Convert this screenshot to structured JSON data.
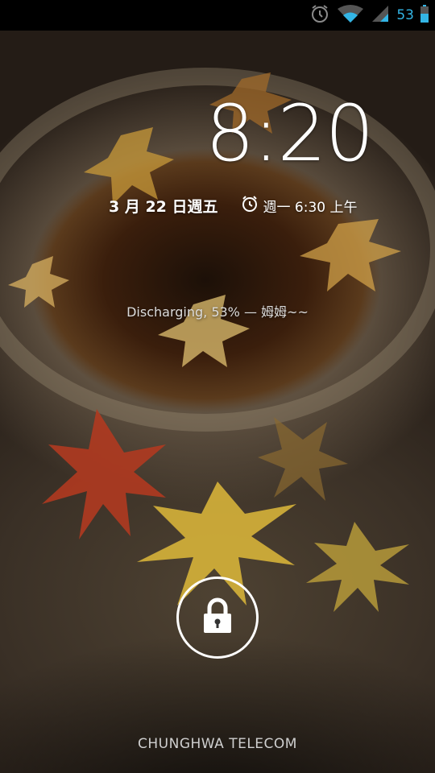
{
  "status_bar": {
    "battery_percent": "53",
    "icons": [
      "alarm-icon",
      "wifi-icon",
      "signal-icon",
      "battery-icon"
    ],
    "accent_color": "#33b5e5"
  },
  "lockscreen": {
    "time": "8:20",
    "date": "3 月 22 日週五",
    "alarm": "週一 6:30 上午",
    "charging_status": "Discharging, 53% — 姆姆~~",
    "unlock_icon": "lock-icon",
    "carrier": "CHUNGHWA TELECOM"
  }
}
